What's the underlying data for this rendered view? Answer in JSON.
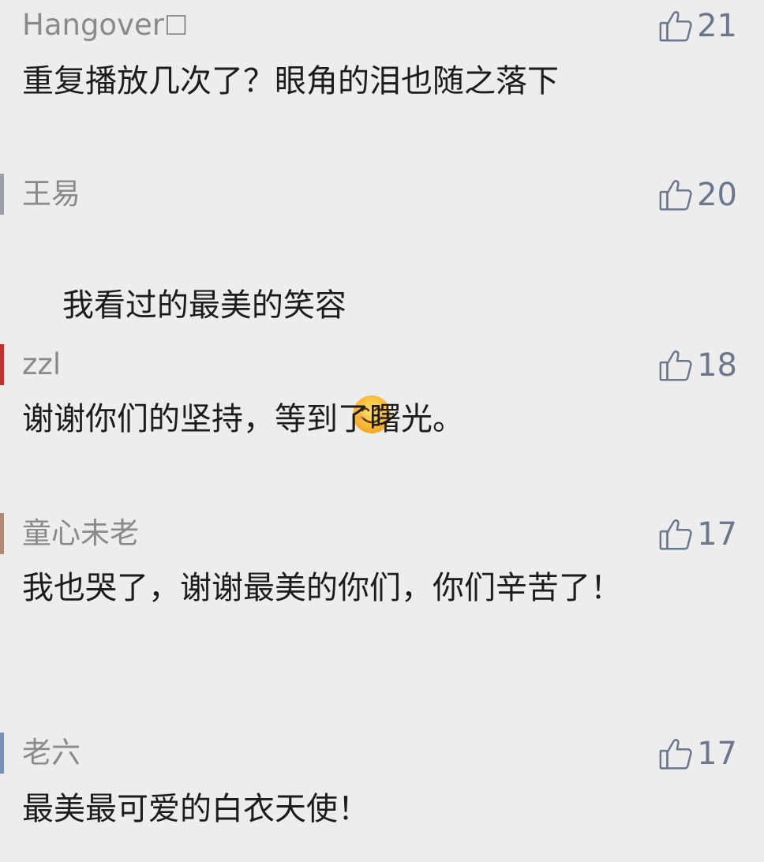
{
  "comments": [
    {
      "username": "Hangover",
      "username_suffix": "☐",
      "text": "重复播放几次了？眼角的泪也随之落下",
      "likes": "21",
      "avatar_color": ""
    },
    {
      "username": "王易",
      "text": "我看过的最美的笑容",
      "emoji": "smiling-face-emoji",
      "likes": "20",
      "avatar_color": "#9aa0a6"
    },
    {
      "username": "zzl",
      "text": "谢谢你们的坚持，等到了曙光。",
      "likes": "18",
      "avatar_color": "#c0322d"
    },
    {
      "username": "童心未老",
      "text": "我也哭了，谢谢最美的你们，你们辛苦了！",
      "likes": "17",
      "avatar_color": "#b08a78"
    },
    {
      "username": "老六",
      "text": "最美最可爱的白衣天使！",
      "likes": "17",
      "avatar_color": "#7a8fb8"
    }
  ],
  "like_icon": "thumbs-up-icon",
  "colors": {
    "background": "#ededed",
    "username": "#8a8a8a",
    "like": "#6b778c",
    "text": "#1c1c1c"
  }
}
